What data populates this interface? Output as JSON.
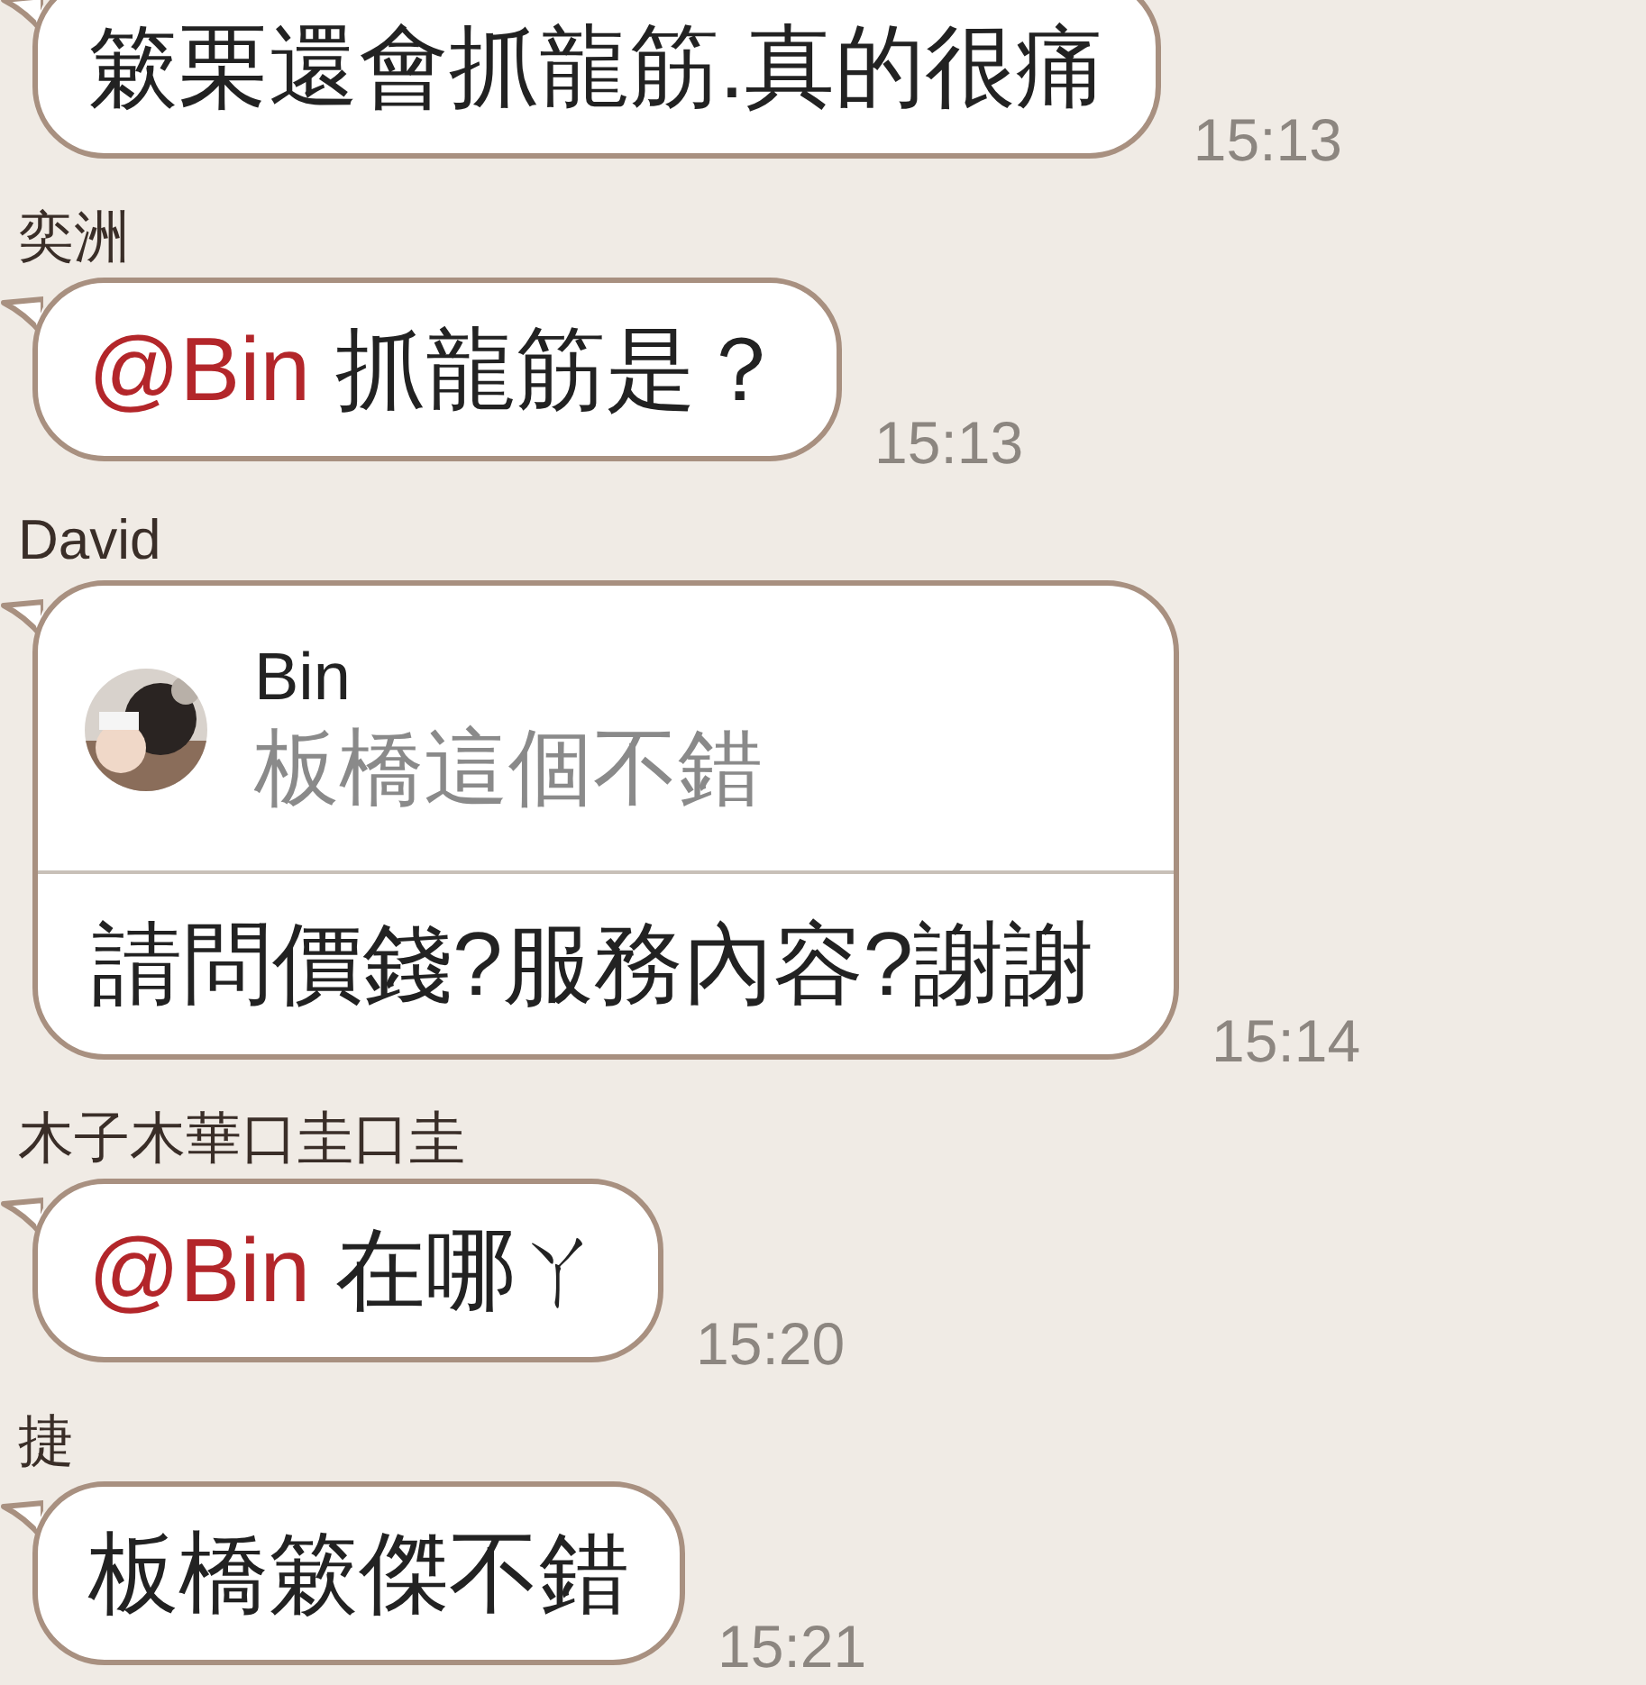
{
  "messages": [
    {
      "kind": "text",
      "text": "簌栗還會抓龍筋.真的很痛",
      "time": "15:13"
    },
    {
      "kind": "text",
      "sender": "奕洲",
      "mention": "@Bin",
      "text": "抓龍筋是？",
      "time": "15:13"
    },
    {
      "kind": "reply",
      "sender": "David",
      "quote": {
        "author": "Bin",
        "text": "板橋這個不錯"
      },
      "text": "請問價錢?服務內容?謝謝",
      "time": "15:14"
    },
    {
      "kind": "text",
      "sender": "木子木華口圭口圭",
      "mention": "@Bin",
      "text": "在哪ㄚ",
      "time": "15:20"
    },
    {
      "kind": "text",
      "sender": "捷",
      "text": "板橋簌傑不錯",
      "time": "15:21"
    }
  ]
}
